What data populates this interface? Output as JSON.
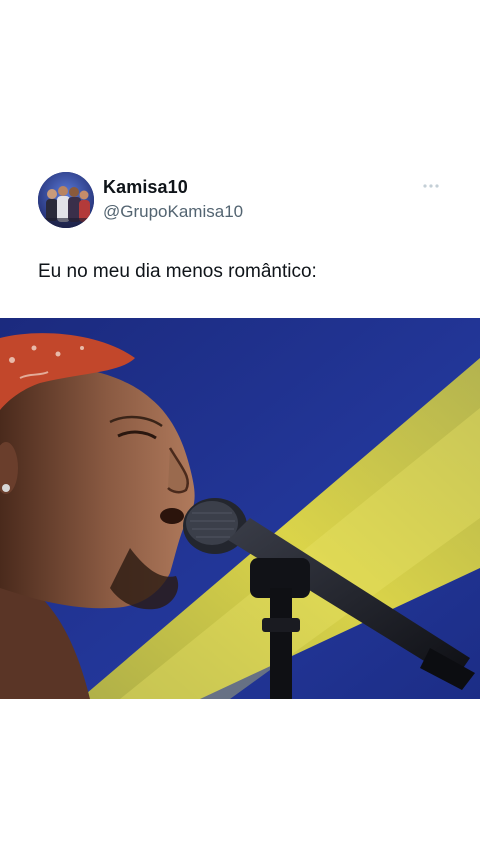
{
  "tweet": {
    "author": {
      "name": "Kamisa10",
      "handle": "@GrupoKamisa10"
    },
    "text": "Eu no meu dia menos romântico:",
    "more_icon": "ellipsis-horizontal-icon",
    "media": {
      "type": "image",
      "subject": "singer-with-microphone"
    }
  },
  "colors": {
    "name_text": "#0f1419",
    "handle_text": "#536471",
    "stage_blue": "#1d2e8c",
    "light_beam": "#d8d23a",
    "bandana": "#c2472b"
  }
}
